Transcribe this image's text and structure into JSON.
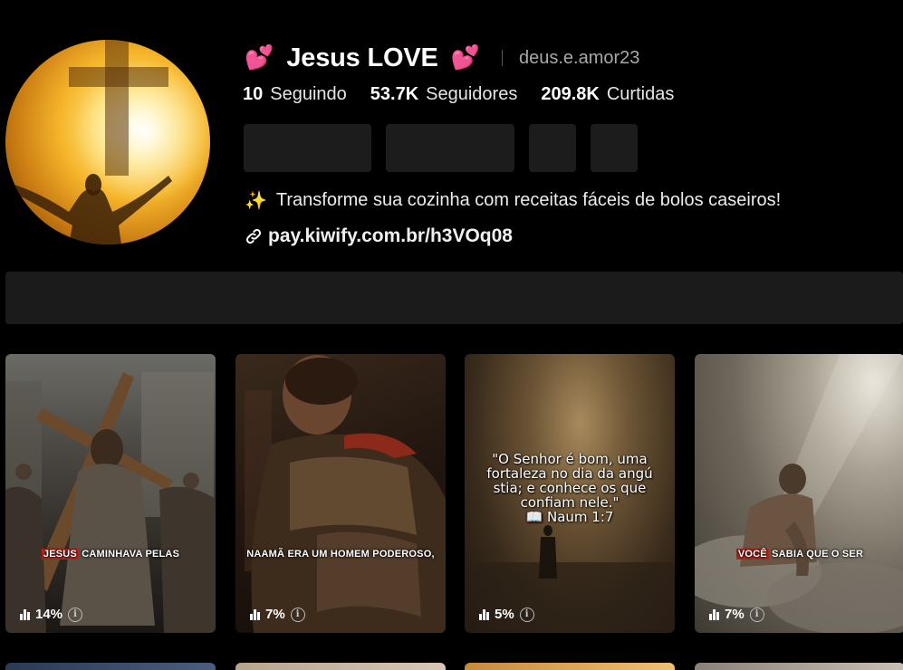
{
  "profile": {
    "heart_left": "💕",
    "display_name": "Jesus LOVE",
    "heart_right": "💕",
    "username": "deus.e.amor23",
    "stats": [
      {
        "value": "10",
        "label": "Seguindo"
      },
      {
        "value": "53.7K",
        "label": "Seguidores"
      },
      {
        "value": "209.8K",
        "label": "Curtidas"
      }
    ],
    "bio_icon": "✨",
    "bio": "Transforme sua cozinha com receitas fáceis de bolos caseiros!",
    "link": "pay.kiwify.com.br/h3VOq08"
  },
  "icons": {
    "link": "link-icon",
    "views": "bar-chart-icon",
    "info": "info-icon"
  },
  "videos": [
    {
      "caption_hl": "JESUS",
      "caption_rest": " CAMINHAVA PELAS",
      "views": "14%"
    },
    {
      "caption_hl": "",
      "caption_rest": "NAAMÃ ERA UM HOMEM PODEROSO,",
      "views": "7%"
    },
    {
      "quote": "\"O Senhor é bom, uma fortaleza no dia da angú stia; e conhece os que confiam nele.\"",
      "quote_ref": "📖 Naum 1:7",
      "views": "5%"
    },
    {
      "caption_hl": "VOCÊ",
      "caption_rest": " SABIA QUE O SER",
      "views": "7%"
    }
  ],
  "colors": {
    "background": "#000000",
    "button": "#1c1c1c",
    "highlight": "#b0261b"
  }
}
